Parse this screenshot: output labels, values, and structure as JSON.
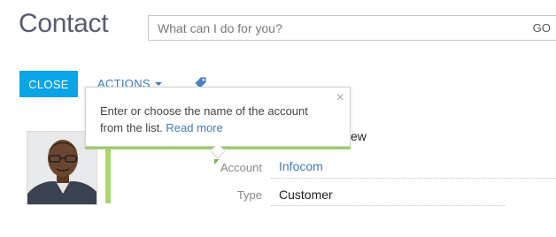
{
  "page": {
    "title": "Contact"
  },
  "command": {
    "placeholder": "What can I do for you?",
    "go_label": "GO"
  },
  "toolbar": {
    "close_label": "CLOSE",
    "actions_label": "ACTIONS",
    "tag_icon": "tag-icon"
  },
  "tooltip": {
    "text": "Enter or choose the name of the account from the list.",
    "link_label": "Read more"
  },
  "profile": {
    "partial_value": "ew"
  },
  "fields": [
    {
      "label": "Account",
      "value": "Infocom"
    },
    {
      "label": "Type",
      "value": "Customer"
    }
  ],
  "colors": {
    "accent": "#0aa5e6",
    "link": "#3f7ac5",
    "highlight": "#a8d86e"
  }
}
